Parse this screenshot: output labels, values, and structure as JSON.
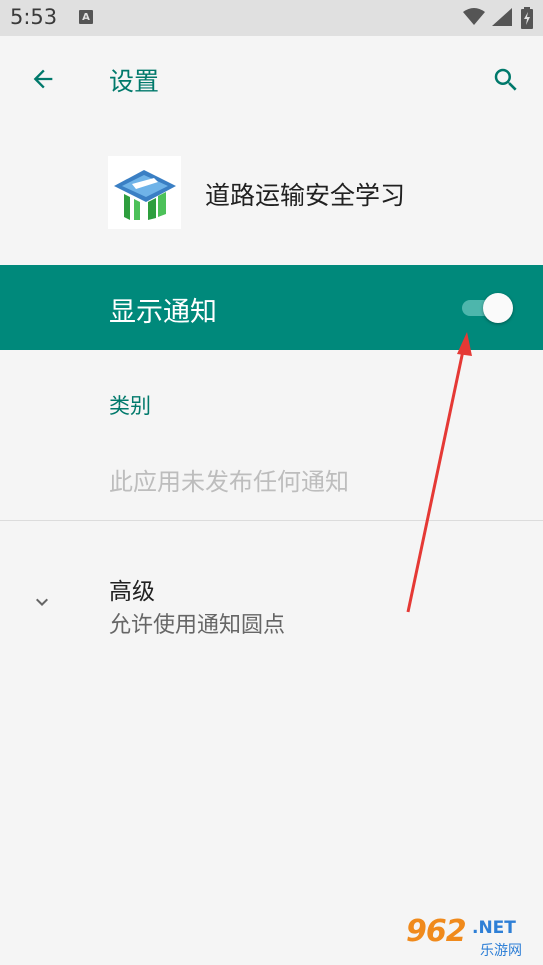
{
  "status_bar": {
    "time": "5:53",
    "notification_badge": "A"
  },
  "app_bar": {
    "title": "设置",
    "back_icon": "arrow-back-icon",
    "search_icon": "search-icon"
  },
  "app_header": {
    "app_name": "道路运输安全学习"
  },
  "notifications": {
    "toggle_label": "显示通知",
    "toggle_on": true
  },
  "categories": {
    "header": "类别",
    "empty_text": "此应用未发布任何通知"
  },
  "advanced": {
    "title": "高级",
    "summary": "允许使用通知圆点"
  },
  "watermark": {
    "digits": "962",
    "net": ".NET",
    "sub": "乐游网"
  },
  "colors": {
    "accent": "#00796b",
    "toggle_row_bg": "#00897b",
    "annotation": "#e53935"
  }
}
